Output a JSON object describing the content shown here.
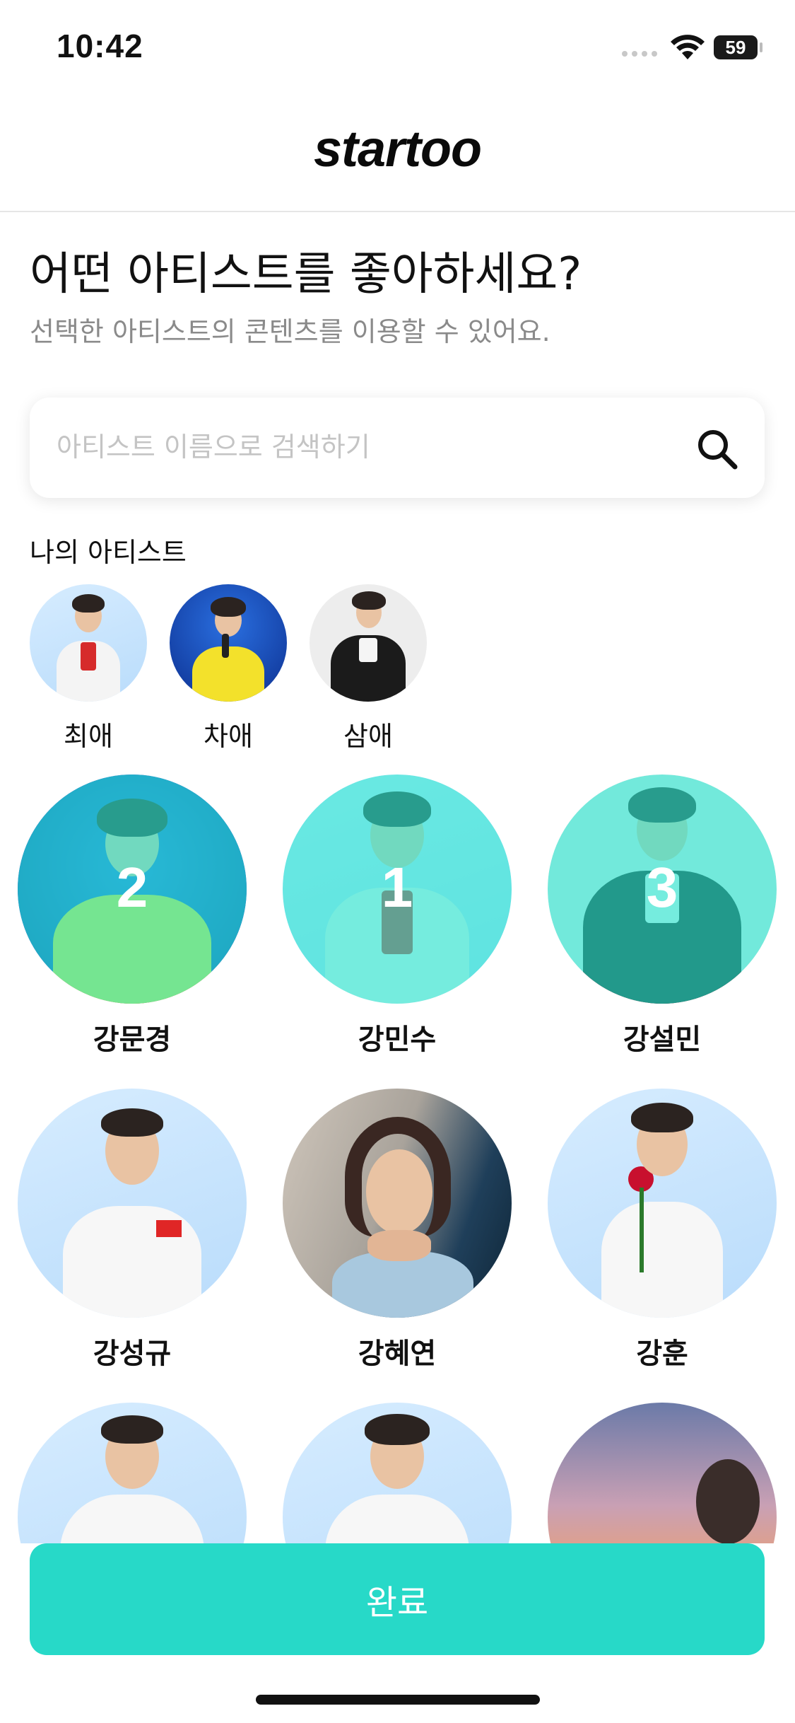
{
  "status_bar": {
    "time": "10:42",
    "battery": "59"
  },
  "header": {
    "logo": "startoo"
  },
  "page": {
    "title": "어떤 아티스트를 좋아하세요?",
    "subtitle": "선택한 아티스트의 콘텐츠를 이용할 수 있어요."
  },
  "search": {
    "placeholder": "아티스트 이름으로 검색하기"
  },
  "my_artists": {
    "label": "나의 아티스트",
    "items": [
      {
        "name": "최애"
      },
      {
        "name": "차애"
      },
      {
        "name": "삼애"
      }
    ]
  },
  "artists": [
    {
      "name": "강문경",
      "selected": true,
      "rank": "2"
    },
    {
      "name": "강민수",
      "selected": true,
      "rank": "1"
    },
    {
      "name": "강설민",
      "selected": true,
      "rank": "3"
    },
    {
      "name": "강성규",
      "selected": false
    },
    {
      "name": "강혜연",
      "selected": false
    },
    {
      "name": "강훈",
      "selected": false
    }
  ],
  "footer": {
    "done_label": "완료"
  },
  "colors": {
    "accent": "#27d9c8",
    "selection_overlay": "#26e6d0"
  }
}
